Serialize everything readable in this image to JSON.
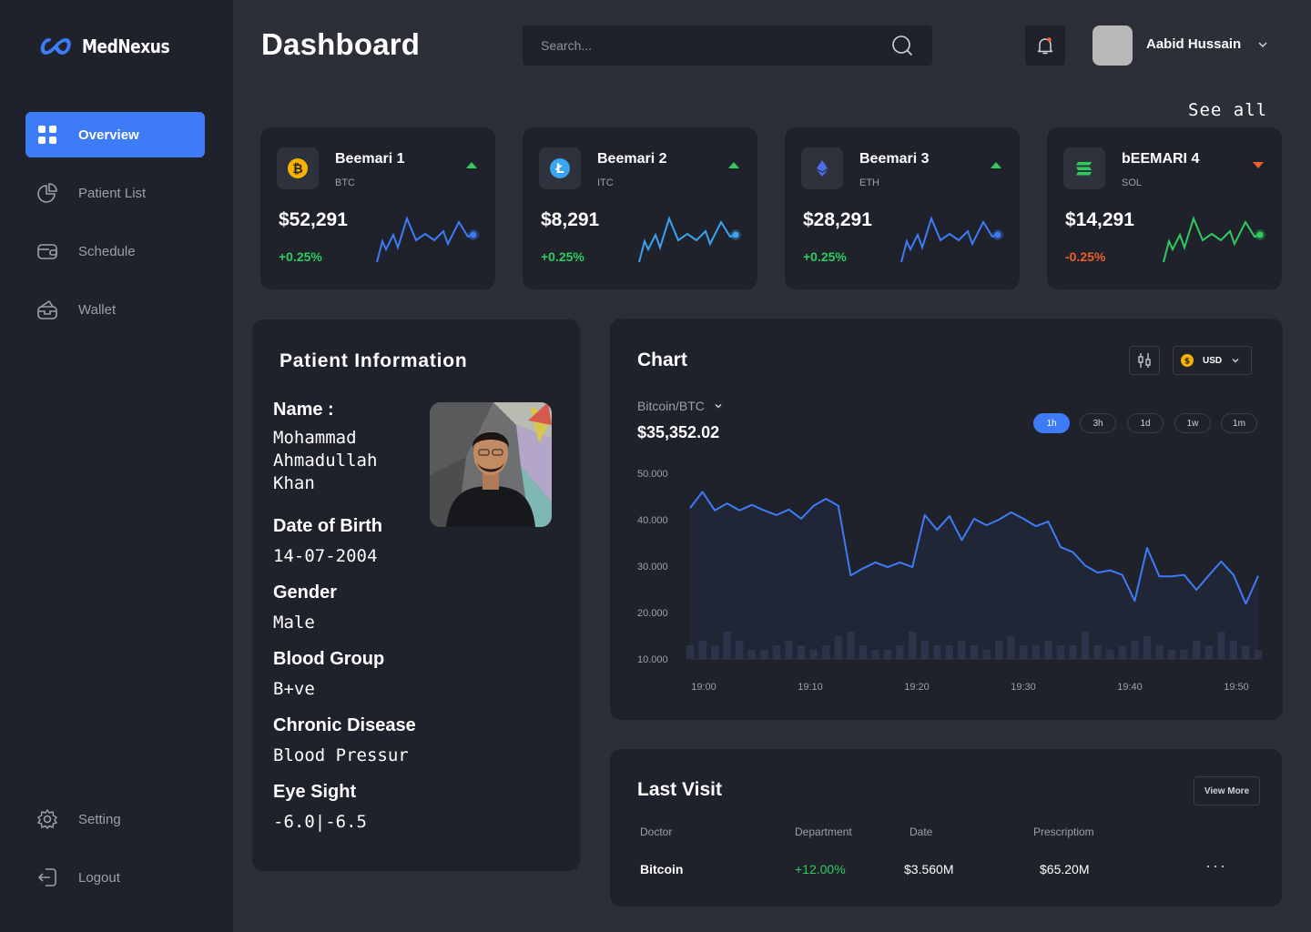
{
  "brand": {
    "name": "MedNexus",
    "color": "#3d7bf7"
  },
  "sidebar": {
    "items": [
      {
        "label": "Overview",
        "icon": "grid-icon",
        "active": true
      },
      {
        "label": "Patient List",
        "icon": "pie-chart-icon",
        "active": false
      },
      {
        "label": "Schedule",
        "icon": "wallet-card-icon",
        "active": false
      },
      {
        "label": "Wallet",
        "icon": "wallet-icon",
        "active": false
      }
    ],
    "bottom": [
      {
        "label": "Setting",
        "icon": "gear-icon"
      },
      {
        "label": "Logout",
        "icon": "logout-icon"
      }
    ]
  },
  "header": {
    "title": "Dashboard",
    "search_placeholder": "Search...",
    "user_name": "Aabid Hussain",
    "see_all": "See all"
  },
  "coins": [
    {
      "name": "Beemari 1",
      "symbol": "BTC",
      "price": "$52,291",
      "change": "+0.25%",
      "trend": "up",
      "icon_color": "#f5b300",
      "spark_color": "#3d7bf7"
    },
    {
      "name": "Beemari 2",
      "symbol": "ITC",
      "price": "$8,291",
      "change": "+0.25%",
      "trend": "up",
      "icon_color": "#3aa4f0",
      "spark_color": "#3aa4f0"
    },
    {
      "name": "Beemari 3",
      "symbol": "ETH",
      "price": "$28,291",
      "change": "+0.25%",
      "trend": "up",
      "icon_color": "#4f6cf0",
      "spark_color": "#3d7bf7"
    },
    {
      "name": "bEEMARI 4",
      "symbol": "SOL",
      "price": "$14,291",
      "change": "-0.25%",
      "trend": "down",
      "icon_color": "#2ecc5f",
      "spark_color": "#2ecc5f"
    }
  ],
  "patient": {
    "title": "Patient Information",
    "name_label": "Name :",
    "name_value_1": "Mohammad",
    "name_value_2": "Ahmadullah",
    "name_value_3": "Khan",
    "dob_label": "Date of Birth",
    "dob_value": "14-07-2004",
    "gender_label": "Gender",
    "gender_value": "Male",
    "blood_label": "Blood Group",
    "blood_value": "B+ve",
    "chronic_label": "Chronic Disease",
    "chronic_value": "Blood Pressur",
    "eye_label": "Eye Sight",
    "eye_value": "-6.0|-6.5"
  },
  "chart": {
    "title": "Chart",
    "currency": "USD",
    "pair": "Bitcoin/BTC",
    "price": "$35,352.02",
    "ranges": [
      "1h",
      "3h",
      "1d",
      "1w",
      "1m"
    ],
    "active_range": "1h"
  },
  "chart_data": {
    "type": "line",
    "title": "Chart",
    "x_ticks": [
      "19:00",
      "19:10",
      "19:20",
      "19:30",
      "19:40",
      "19:50"
    ],
    "y_ticks": [
      "50.000",
      "40.000",
      "30.000",
      "20.000",
      "10.000"
    ],
    "ylim": [
      10000,
      50000
    ],
    "series": [
      {
        "values": [
          42500,
          46000,
          42000,
          43500,
          42000,
          43200,
          42000,
          41000,
          42200,
          40200,
          43000,
          44500,
          43000,
          28000,
          29500,
          30800,
          29800,
          30800,
          29800,
          41000,
          37800,
          40800,
          35600,
          40200,
          38800,
          40000,
          41600,
          40200,
          38600,
          39600,
          34100,
          33000,
          30100,
          28600,
          29100,
          28100,
          22500,
          33900,
          27800,
          27800,
          28100,
          24900,
          28000,
          31000,
          28100,
          21900,
          27900
        ]
      }
    ],
    "volume": [
      3,
      4,
      3,
      6,
      4,
      2,
      2,
      3,
      4,
      3,
      2,
      3,
      5,
      6,
      3,
      2,
      2,
      3,
      6,
      4,
      3,
      3,
      4,
      3,
      2,
      4,
      5,
      3,
      3,
      4,
      3,
      3,
      6,
      3,
      2,
      3,
      4,
      5,
      3,
      2,
      2,
      4,
      3,
      6,
      4,
      3,
      2
    ]
  },
  "last_visit": {
    "title": "Last Visit",
    "view_more": "View More",
    "headers": [
      "Doctor",
      "Department",
      "Date",
      "Prescriptiom"
    ],
    "row": [
      "Bitcoin",
      "+12.00%",
      "$3.560M",
      "$65.20M"
    ],
    "more": "···"
  }
}
